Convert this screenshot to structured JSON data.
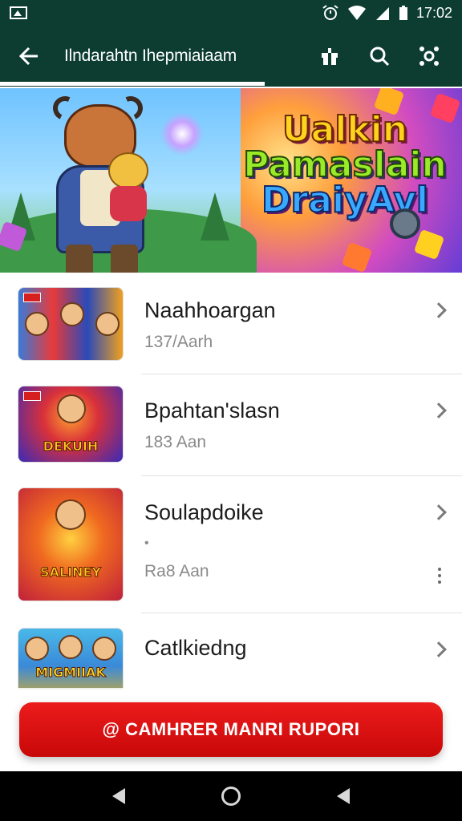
{
  "status_bar": {
    "time": "17:02"
  },
  "app_bar": {
    "title": "Ilndarahtn Ihepmiaiaam",
    "icons": [
      "back-arrow-icon",
      "gift-icon",
      "search-icon",
      "settings-icon"
    ]
  },
  "banner": {
    "title_line1": "Ualkin",
    "title_line2": "Pamaslain",
    "title_line3": "DraiyAvl"
  },
  "list": {
    "items": [
      {
        "title": "Naahhoargan",
        "subtitle": "137/Aarh",
        "thumb_label": ""
      },
      {
        "title": "Bpahtan'slasn",
        "subtitle": "183 Aan",
        "thumb_label": "DEKUIH"
      },
      {
        "title": "Soulapdoike",
        "subtitle": "Ra8 Aan",
        "dot": "•",
        "thumb_label": "SALINEY"
      },
      {
        "title": "Catlkiedng",
        "subtitle": "",
        "thumb_label": "MIGMIIAK"
      }
    ]
  },
  "cta": {
    "label": "@ CAMHRER MANRI RUPORI"
  },
  "colors": {
    "app_bar": "#0c3d30",
    "cta": "#e01414",
    "chevron": "#7a7a7a"
  }
}
